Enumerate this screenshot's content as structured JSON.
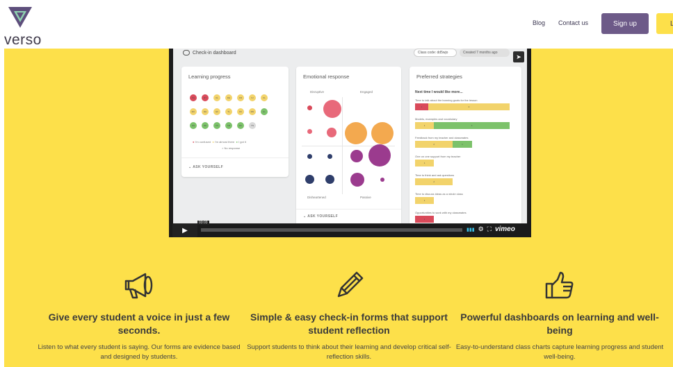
{
  "header": {
    "logo_text": "verso",
    "nav": [
      "Blog",
      "Contact us"
    ],
    "signup_label": "Sign up",
    "login_label": "L"
  },
  "colors": {
    "hero_bg": "#fde04a",
    "signup_bg": "#6d5a88",
    "logo": "#5e4f7c"
  },
  "dashboard": {
    "title": "Check-in dashboard",
    "class_code": "Class code: dd5wjo",
    "created": "Created 7 months ago",
    "learning": {
      "title": "Learning progress",
      "dots": [
        {
          "t": "PH",
          "c": "#d94a5a"
        },
        {
          "t": "MY",
          "c": "#d94a5a"
        },
        {
          "t": "CL",
          "c": "#f2d36b"
        },
        {
          "t": "DH",
          "c": "#f2d36b"
        },
        {
          "t": "FR",
          "c": "#f2d36b"
        },
        {
          "t": "IU",
          "c": "#f2d36b"
        },
        {
          "t": "FL",
          "c": "#f2d36b"
        },
        {
          "t": "MC",
          "c": "#f2d36b"
        },
        {
          "t": "RH",
          "c": "#f2d36b"
        },
        {
          "t": "GF",
          "c": "#f2d36b"
        },
        {
          "t": "TL",
          "c": "#f2d36b"
        },
        {
          "t": "FK",
          "c": "#f2d36b"
        },
        {
          "t": "MN",
          "c": "#f2d36b"
        },
        {
          "t": "EL",
          "c": "#7cc26a"
        },
        {
          "t": "DN",
          "c": "#7cc26a"
        },
        {
          "t": "RD",
          "c": "#7cc26a"
        },
        {
          "t": "CS",
          "c": "#7cc26a"
        },
        {
          "t": "SM",
          "c": "#7cc26a"
        },
        {
          "t": "MC",
          "c": "#7cc26a"
        },
        {
          "t": "TN",
          "c": "#d9d9d9"
        }
      ],
      "legend": [
        "I'm confused",
        "I'm almost there",
        "I got it",
        "No response"
      ],
      "ask": "ASK YOURSELF"
    },
    "emotional": {
      "title": "Emotional response",
      "quadrants": [
        "Disruptive",
        "Engaged",
        "Disheartened",
        "Passive"
      ],
      "ask": "ASK YOURSELF"
    },
    "strategies": {
      "title": "Preferred strategies",
      "heading": "Next time I would like more...",
      "items": [
        {
          "label": "Time to talk about the learning goals for the lesson",
          "bars": [
            {
              "w": 14,
              "c": "#d94a5a",
              "t": "1"
            },
            {
              "w": 86,
              "c": "#f2d36b",
              "t": "4"
            }
          ]
        },
        {
          "label": "Models, examples and vocabulary",
          "bars": [
            {
              "w": 20,
              "c": "#f2d36b",
              "t": "1"
            },
            {
              "w": 80,
              "c": "#7cc26a",
              "t": "4"
            }
          ]
        },
        {
          "label": "Feedback from my teacher and classmates",
          "bars": [
            {
              "w": 40,
              "c": "#f2d36b",
              "t": "2"
            },
            {
              "w": 20,
              "c": "#7cc26a",
              "t": "1"
            }
          ]
        },
        {
          "label": "One on one support from my teacher",
          "bars": [
            {
              "w": 20,
              "c": "#f2d36b",
              "t": "1"
            }
          ]
        },
        {
          "label": "Time to think and ask questions",
          "bars": [
            {
              "w": 40,
              "c": "#f2d36b",
              "t": "2"
            }
          ]
        },
        {
          "label": "Time to discuss ideas as a whole class",
          "bars": [
            {
              "w": 20,
              "c": "#f2d36b",
              "t": "1"
            }
          ]
        },
        {
          "label": "Opportunities to work with my classmates",
          "bars": [
            {
              "w": 20,
              "c": "#d94a5a",
              "t": "1"
            }
          ]
        }
      ]
    }
  },
  "video": {
    "time": "03:03",
    "brand": "vimeo"
  },
  "features": [
    {
      "icon": "megaphone-icon",
      "title": "Give every student a voice in just a few seconds.",
      "desc": "Listen to what every student is saying. Our forms are evidence based and designed by students."
    },
    {
      "icon": "pencil-icon",
      "title": "Simple & easy check-in forms that support student reflection",
      "desc": "Support students to think about their learning and develop critical self-reflection skills."
    },
    {
      "icon": "thumbs-up-icon",
      "title": "Powerful dashboards on learning and well-being",
      "desc": "Easy-to-understand class charts capture learning progress and student well-being."
    }
  ]
}
